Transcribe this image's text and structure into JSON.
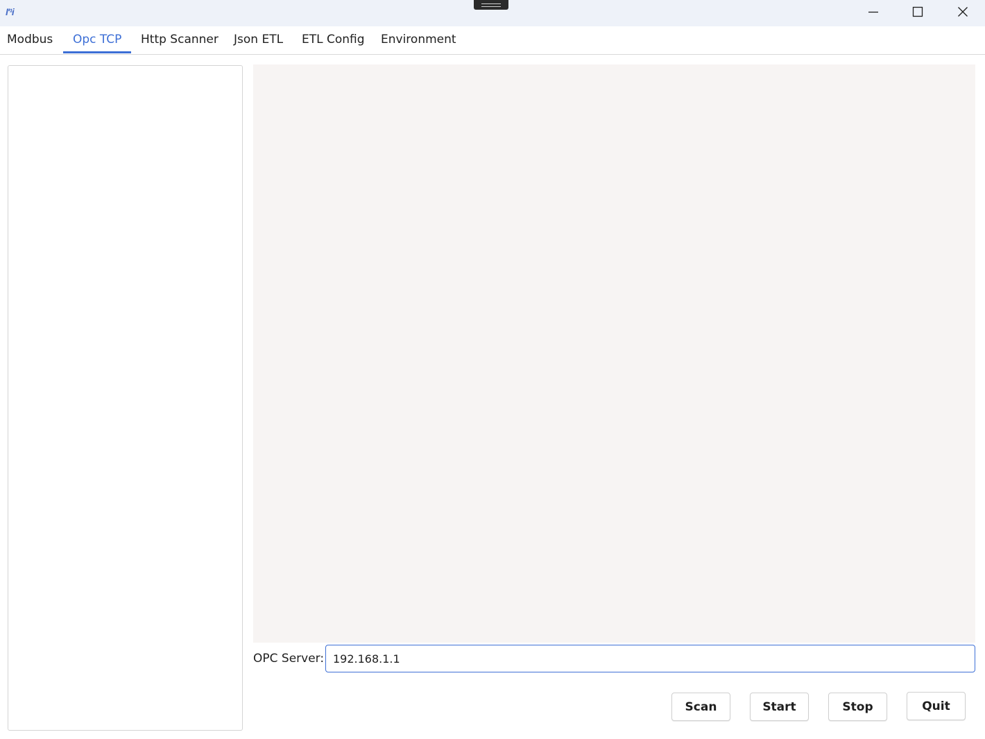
{
  "window": {
    "app_icon_text": "I'¹i",
    "controls": {
      "minimize_icon": "minimize-icon",
      "maximize_icon": "maximize-icon",
      "close_icon": "close-icon"
    }
  },
  "tabs": [
    {
      "label": "Modbus",
      "active": false
    },
    {
      "label": "Opc TCP",
      "active": true
    },
    {
      "label": "Http Scanner",
      "active": false
    },
    {
      "label": "Json ETL",
      "active": false
    },
    {
      "label": "ETL Config",
      "active": false
    },
    {
      "label": "Environment",
      "active": false
    }
  ],
  "opc": {
    "server_label": "OPC Server:",
    "server_value": "192.168.1.1"
  },
  "actions": {
    "scan_label": "Scan",
    "start_label": "Start",
    "stop_label": "Stop",
    "quit_label": "Quit"
  },
  "colors": {
    "accent": "#3d6fd6",
    "titlebar_bg": "#eef2f9",
    "output_bg": "#f7f4f3"
  }
}
